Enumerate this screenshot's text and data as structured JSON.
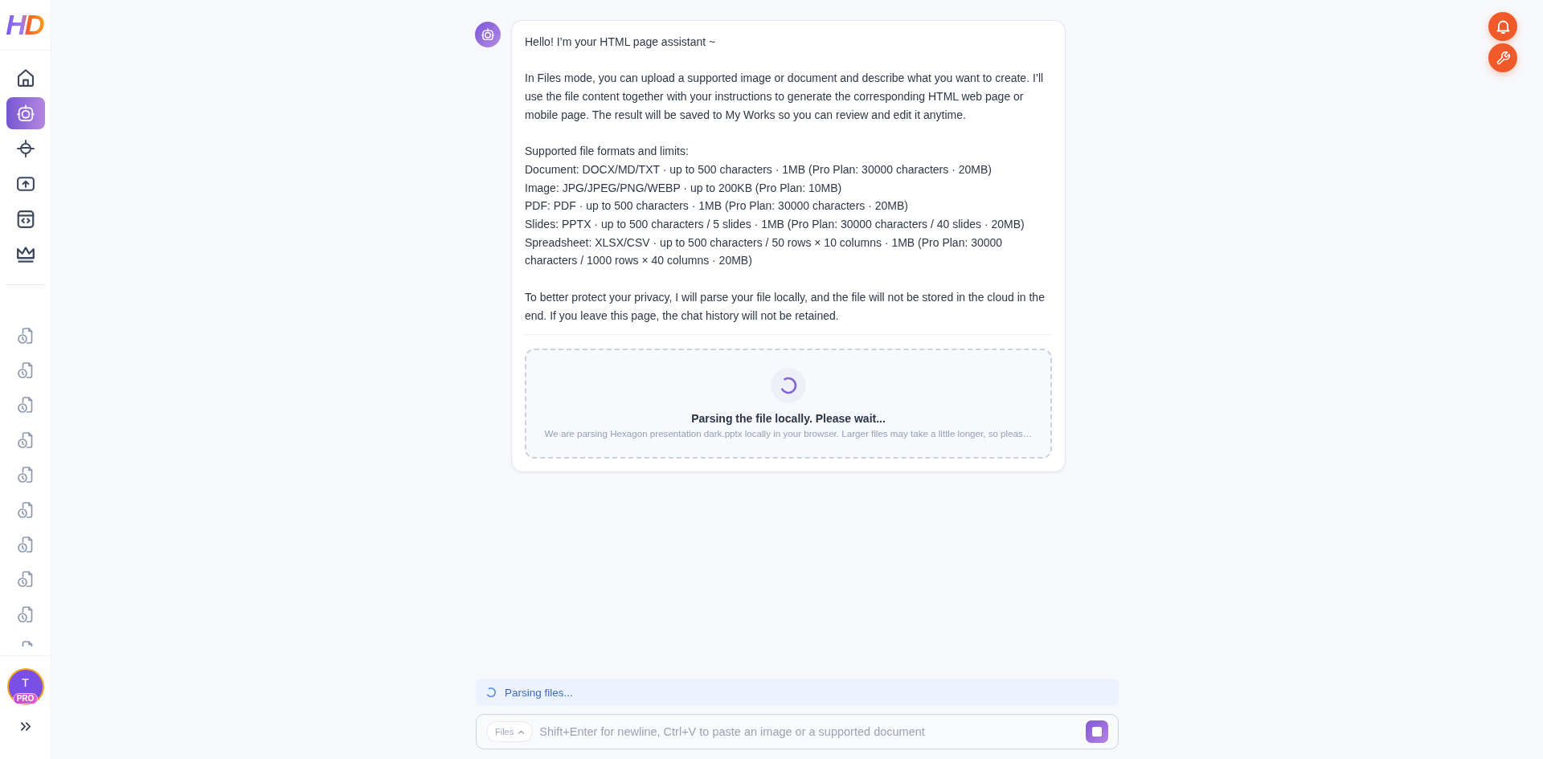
{
  "sidebar": {
    "logo": "HD",
    "nav": [
      {
        "selected": false
      },
      {
        "selected": true
      },
      {
        "selected": false
      },
      {
        "selected": false
      },
      {
        "selected": false
      },
      {
        "selected": false
      }
    ],
    "user": {
      "initial": "T",
      "badge": "PRO"
    }
  },
  "message": {
    "greeting": "Hello! I’m your HTML page assistant ~",
    "intro": "In Files mode, you can upload a supported image or document and describe what you want to create. I’ll use the file content together with your instructions to generate the corresponding HTML web page or mobile page. The result will be saved to My Works so you can review and edit it anytime.",
    "formats": {
      "heading": "Supported file formats and limits:",
      "lines": [
        "Document: DOCX/MD/TXT · up to 500 characters · 1MB (Pro Plan: 30000 characters · 20MB)",
        "Image: JPG/JPEG/PNG/WEBP · up to 200KB (Pro Plan: 10MB)",
        "PDF: PDF · up to 500 characters · 1MB (Pro Plan: 30000 characters · 20MB)",
        "Slides: PPTX · up to 500 characters / 5 slides · 1MB (Pro Plan: 30000 characters / 40 slides · 20MB)",
        "Spreadsheet: XLSX/CSV · up to 500 characters / 50 rows × 10 columns · 1MB (Pro Plan: 30000 characters / 1000 rows × 40 columns · 20MB)"
      ]
    },
    "privacy": "To better protect your privacy, I will parse your file locally, and the file will not be stored in the cloud in the end. If you leave this page, the chat history will not be retained.",
    "upload": {
      "title": "Parsing the file locally. Please wait...",
      "detail": "We are parsing Hexagon presentation dark.pptx locally in your browser. Larger files may take a little longer, so pleas…"
    }
  },
  "status": {
    "text": "Parsing files..."
  },
  "composer": {
    "mode": "Files",
    "placeholder": "Shift+Enter for newline, Ctrl+V to paste an image or a supported document"
  }
}
